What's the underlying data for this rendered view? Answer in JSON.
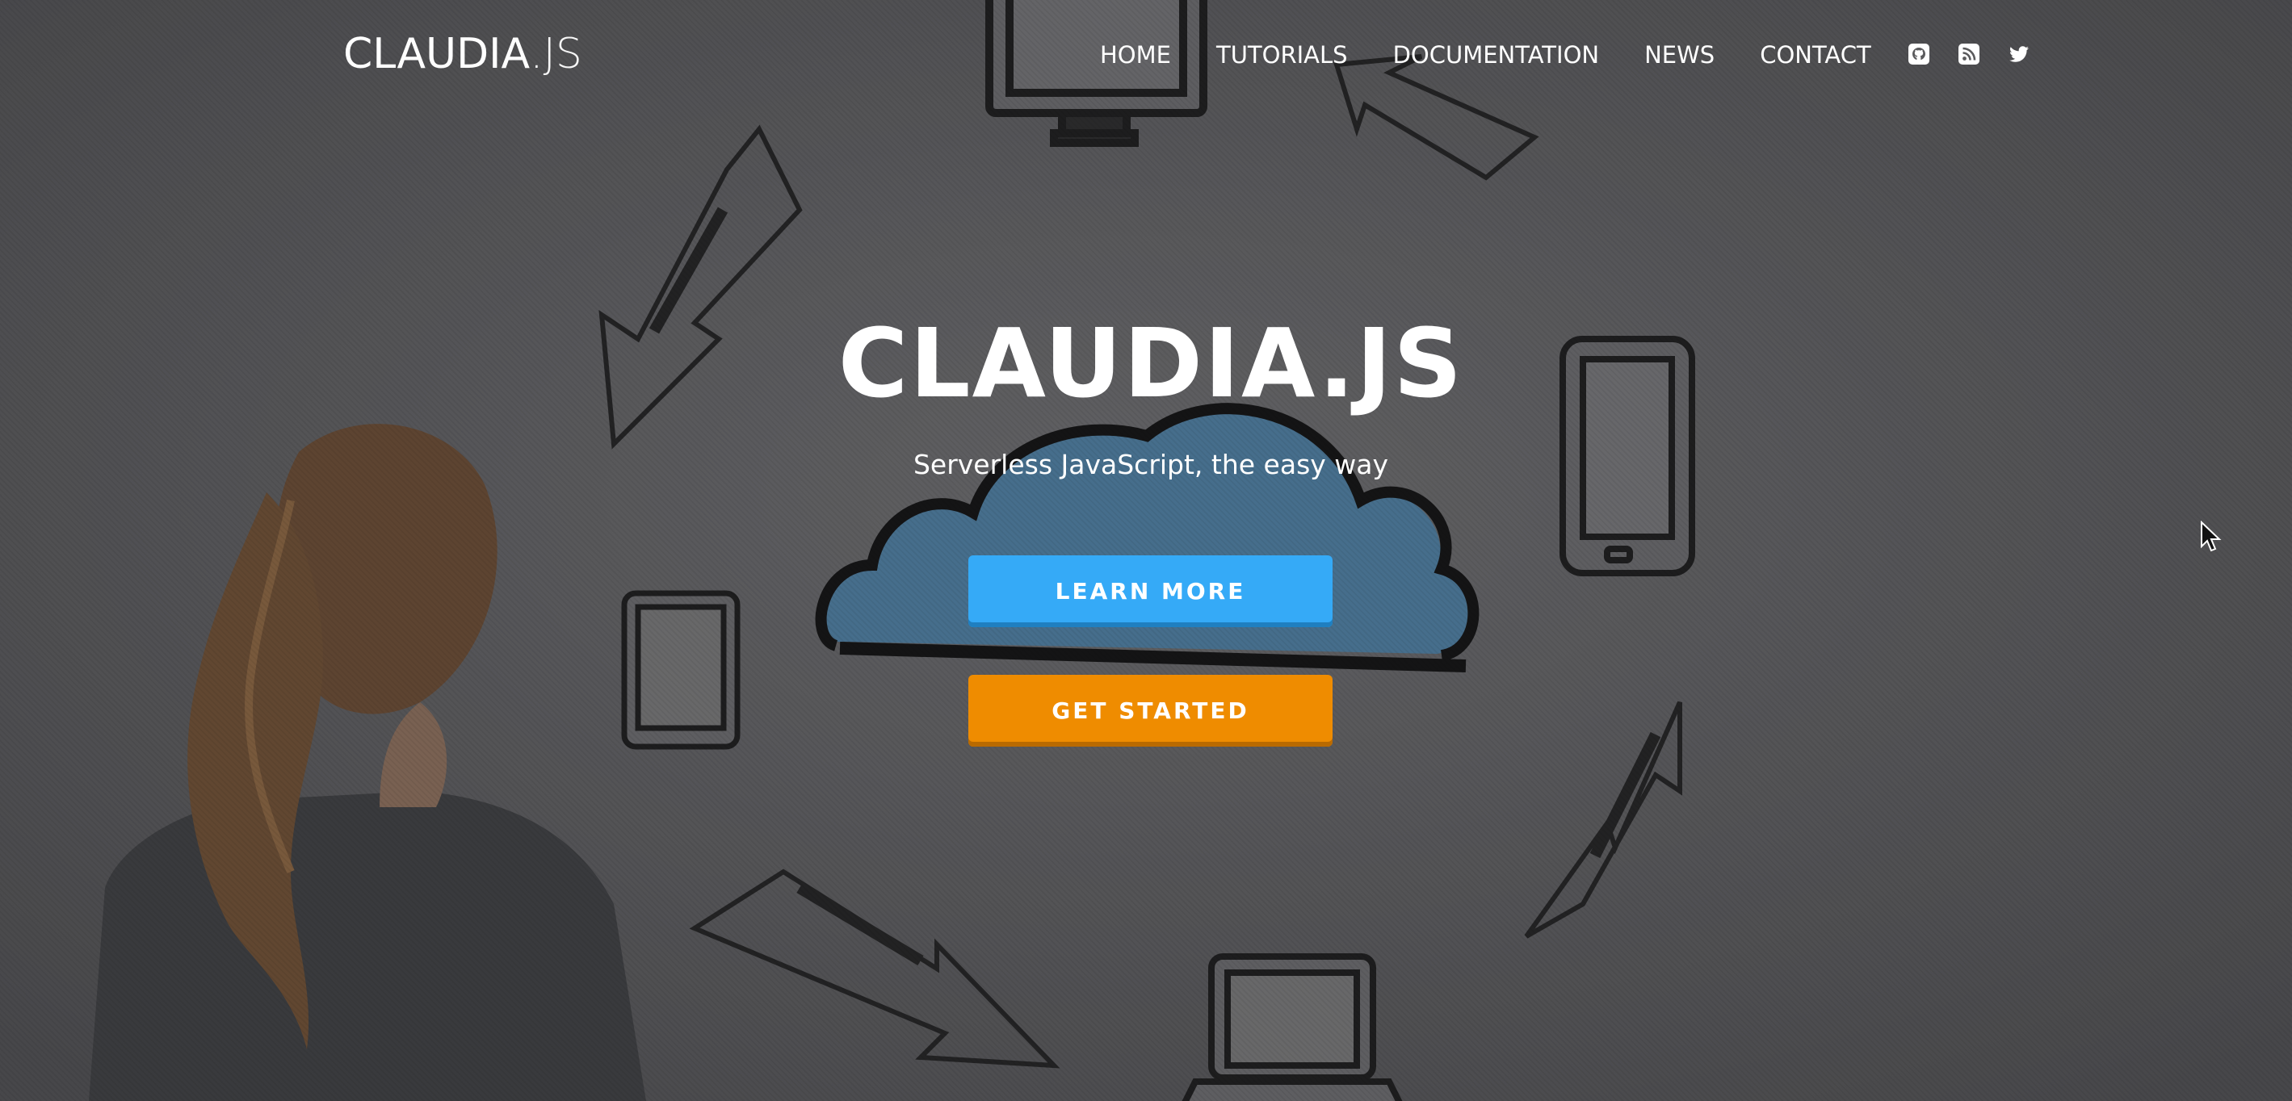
{
  "nav": {
    "brand_main": "CLAUDIA",
    "brand_suffix": ".JS",
    "links": [
      {
        "label": "HOME"
      },
      {
        "label": "TUTORIALS"
      },
      {
        "label": "DOCUMENTATION"
      },
      {
        "label": "NEWS"
      },
      {
        "label": "CONTACT"
      }
    ],
    "icons": [
      "github-icon",
      "rss-icon",
      "twitter-icon"
    ]
  },
  "hero": {
    "title": "CLAUDIA.JS",
    "subtitle": "Serverless JavaScript, the easy way",
    "learn_more_label": "LEARN MORE",
    "get_started_label": "GET STARTED"
  },
  "colors": {
    "learn_more": "#35aaf7",
    "get_started": "#ef8c00",
    "background": "#5c5c5e"
  }
}
